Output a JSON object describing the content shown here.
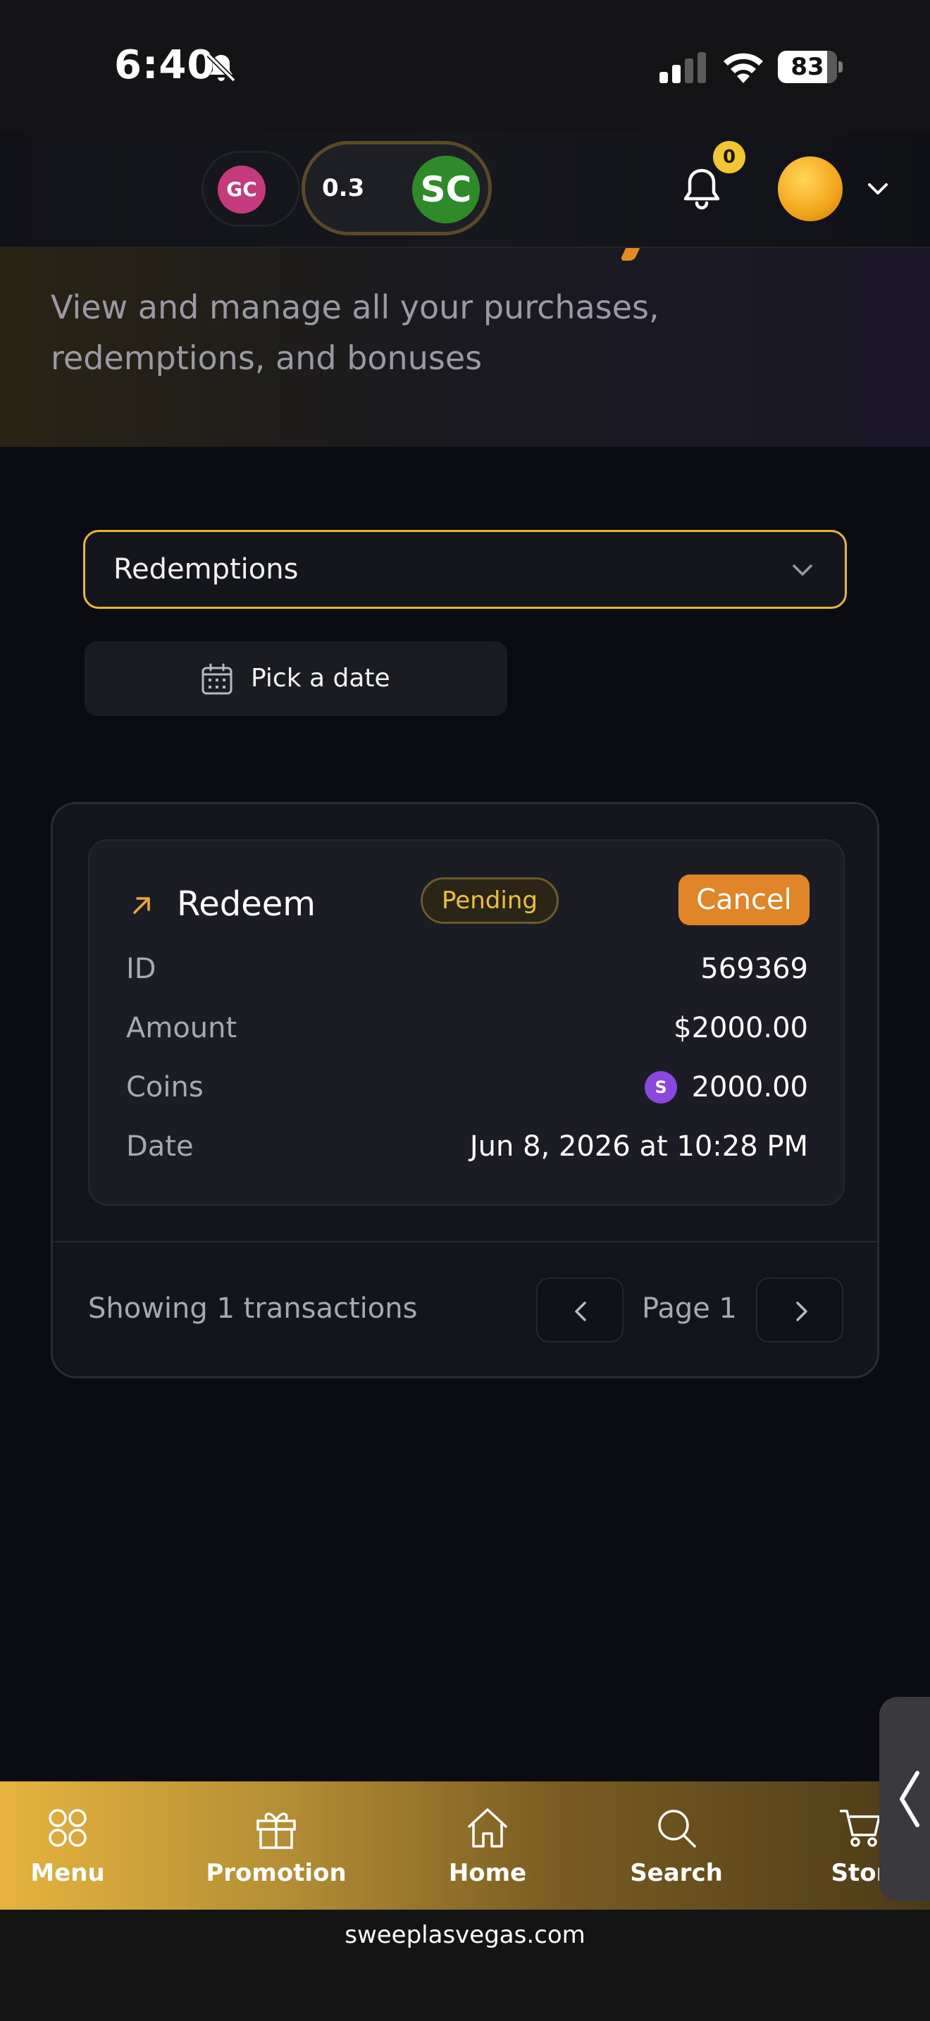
{
  "status_bar": {
    "time": "6:40",
    "battery": "83",
    "battery_level": 0.83
  },
  "header": {
    "gc_label": "GC",
    "sc_amount": "0.3",
    "sc_label": "SC",
    "notification_count": "0"
  },
  "hero": {
    "subtitle": "View and manage all your purchases, redemptions, and bonuses"
  },
  "filters": {
    "type_selected": "Redemptions",
    "date_placeholder": "Pick a date"
  },
  "transaction": {
    "type": "Redeem",
    "status": "Pending",
    "cancel_label": "Cancel",
    "id_label": "ID",
    "id_value": "569369",
    "amount_label": "Amount",
    "amount_value": "$2000.00",
    "coins_label": "Coins",
    "coin_symbol": "S",
    "coins_value": "2000.00",
    "date_label": "Date",
    "date_value": "Jun 8, 2026 at 10:28 PM"
  },
  "pagination": {
    "showing": "Showing 1 transactions",
    "page": "Page 1"
  },
  "bottom_nav": {
    "items": [
      {
        "label": "Menu",
        "icon": "grid-icon"
      },
      {
        "label": "Promotion",
        "icon": "gift-icon"
      },
      {
        "label": "Home",
        "icon": "home-icon"
      },
      {
        "label": "Search",
        "icon": "search-icon"
      },
      {
        "label": "Stor",
        "icon": "cart-icon"
      }
    ]
  },
  "browser": {
    "url": "sweeplasvegas.com"
  },
  "colors": {
    "accent": "#e9b43a",
    "cancel": "#e08628",
    "pending": "#f0bf3a",
    "gc": "#c53a7d",
    "sc": "#2f8a2a"
  }
}
